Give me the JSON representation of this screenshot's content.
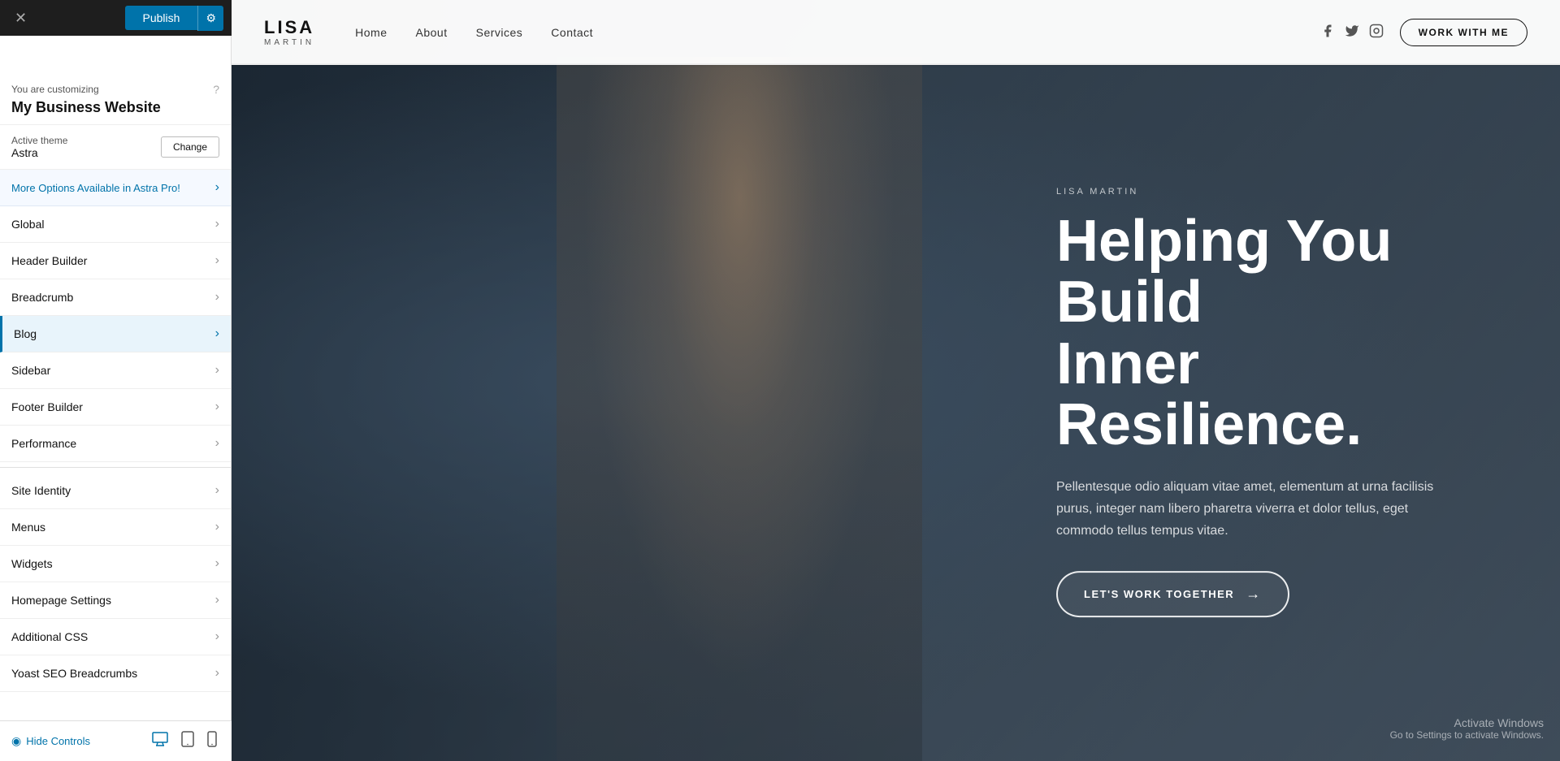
{
  "topbar": {
    "close_icon": "✕",
    "publish_label": "Publish",
    "settings_icon": "⚙"
  },
  "sidebar": {
    "customizing_label": "You are customizing",
    "help_icon": "?",
    "site_title": "My Business Website",
    "active_theme_label": "Active theme",
    "active_theme_name": "Astra",
    "change_btn_label": "Change",
    "promo_label": "More Options Available in Astra Pro!",
    "promo_chevron": "›",
    "menu_items": [
      {
        "label": "Global",
        "active": false
      },
      {
        "label": "Header Builder",
        "active": false
      },
      {
        "label": "Breadcrumb",
        "active": false
      },
      {
        "label": "Blog",
        "active": true
      },
      {
        "label": "Sidebar",
        "active": false
      },
      {
        "label": "Footer Builder",
        "active": false
      },
      {
        "label": "Performance",
        "active": false
      },
      {
        "label": "Site Identity",
        "active": false
      },
      {
        "label": "Menus",
        "active": false
      },
      {
        "label": "Widgets",
        "active": false
      },
      {
        "label": "Homepage Settings",
        "active": false
      },
      {
        "label": "Additional CSS",
        "active": false
      },
      {
        "label": "Yoast SEO Breadcrumbs",
        "active": false
      }
    ],
    "hide_controls_label": "Hide Controls",
    "device_icons": [
      "desktop",
      "tablet",
      "mobile"
    ]
  },
  "website": {
    "nav": {
      "logo_name": "LISA",
      "logo_sub": "MARTIN",
      "links": [
        "Home",
        "About",
        "Services",
        "Contact"
      ],
      "cta_label": "WORK WITH ME",
      "social": [
        "facebook",
        "twitter",
        "instagram"
      ]
    },
    "hero": {
      "subtitle": "LISA MARTIN",
      "title_line1": "Helping You Build",
      "title_line2": "Inner Resilience.",
      "body": "Pellentesque odio aliquam vitae amet, elementum at urna facilisis purus, integer nam libero pharetra viverra et dolor tellus, eget commodo tellus tempus vitae.",
      "cta_label": "LET'S WORK TOGETHER",
      "cta_arrow": "→"
    },
    "watermark": {
      "line1": "Activate Windows",
      "line2": "Go to Settings to activate Windows."
    }
  }
}
